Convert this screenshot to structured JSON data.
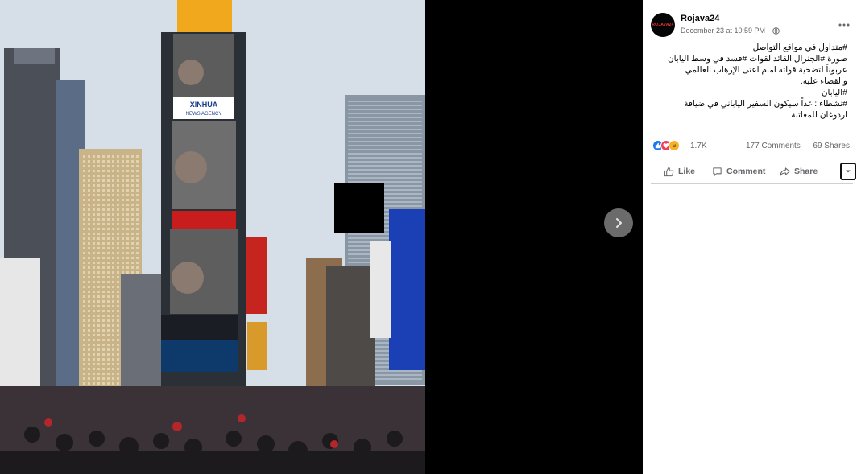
{
  "viewer": {
    "photo_alt": "Times Square billboards",
    "billboard_texts": {
      "xinhua": "XINHUA",
      "news_agency": "NEWS AGENCY"
    },
    "next_icon": "chevron-right-icon"
  },
  "post": {
    "author": "Rojava24",
    "avatar_text": "ROJAVA24",
    "timestamp": "December 23 at 10:59 PM",
    "separator": "·",
    "privacy_icon": "globe-icon",
    "more_icon": "ellipsis-icon",
    "lines": [
      "#متداول في مواقع التواصل",
      "صورة #الجنرال القائد لقوات #قسد في وسط اليابان",
      "عربوناً لتضحية قواته امام اعتى الإرهاب العالمي",
      "والقضاء عليه.",
      "#اليابان",
      "#نشطاء : غداً سيكون السفير الياباني في ضيافة",
      "اردوغان للمعاتبة"
    ],
    "reactions": [
      "like-icon",
      "love-icon",
      "care-icon"
    ],
    "reaction_count": "1.7K",
    "comments": "177 Comments",
    "shares": "69 Shares",
    "actions": {
      "like": "Like",
      "comment": "Comment",
      "share": "Share"
    }
  },
  "colors": {
    "like_blue": "#1877f2",
    "love_red": "#f33e58",
    "care_yellow": "#f7b125",
    "secondary_text": "#65676b"
  }
}
